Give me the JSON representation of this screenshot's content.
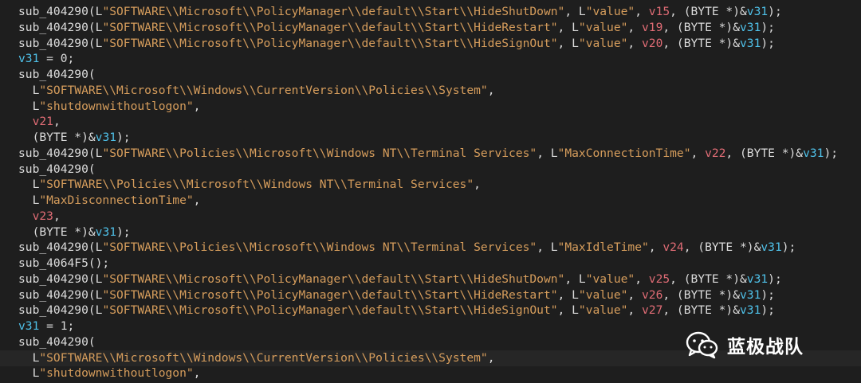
{
  "watermark": {
    "text": "蓝极战队",
    "icon": "wechat-icon"
  },
  "colors": {
    "background": "#1e1e1e",
    "plain": "#dcdcdc",
    "string": "#d69d5c",
    "local_var": "#e06c75",
    "global_var": "#4fc1e9"
  },
  "lines": [
    [
      [
        "p",
        "sub_404290(L"
      ],
      [
        "s",
        "\"SOFTWARE\\\\Microsoft\\\\PolicyManager\\\\default\\\\Start\\\\HideShutDown\""
      ],
      [
        "p",
        ", L"
      ],
      [
        "s",
        "\"value\""
      ],
      [
        "p",
        ", "
      ],
      [
        "v",
        "v15"
      ],
      [
        "p",
        ", (BYTE *)&"
      ],
      [
        "g",
        "v31"
      ],
      [
        "p",
        ");"
      ]
    ],
    [
      [
        "p",
        "sub_404290(L"
      ],
      [
        "s",
        "\"SOFTWARE\\\\Microsoft\\\\PolicyManager\\\\default\\\\Start\\\\HideRestart\""
      ],
      [
        "p",
        ", L"
      ],
      [
        "s",
        "\"value\""
      ],
      [
        "p",
        ", "
      ],
      [
        "v",
        "v19"
      ],
      [
        "p",
        ", (BYTE *)&"
      ],
      [
        "g",
        "v31"
      ],
      [
        "p",
        ");"
      ]
    ],
    [
      [
        "p",
        "sub_404290(L"
      ],
      [
        "s",
        "\"SOFTWARE\\\\Microsoft\\\\PolicyManager\\\\default\\\\Start\\\\HideSignOut\""
      ],
      [
        "p",
        ", L"
      ],
      [
        "s",
        "\"value\""
      ],
      [
        "p",
        ", "
      ],
      [
        "v",
        "v20"
      ],
      [
        "p",
        ", (BYTE *)&"
      ],
      [
        "g",
        "v31"
      ],
      [
        "p",
        ");"
      ]
    ],
    [
      [
        "g",
        "v31"
      ],
      [
        "p",
        " = 0;"
      ]
    ],
    [
      [
        "p",
        "sub_404290("
      ]
    ],
    [
      [
        "p",
        "  L"
      ],
      [
        "s",
        "\"SOFTWARE\\\\Microsoft\\\\Windows\\\\CurrentVersion\\\\Policies\\\\System\""
      ],
      [
        "p",
        ","
      ]
    ],
    [
      [
        "p",
        "  L"
      ],
      [
        "s",
        "\"shutdownwithoutlogon\""
      ],
      [
        "p",
        ","
      ]
    ],
    [
      [
        "p",
        "  "
      ],
      [
        "v",
        "v21"
      ],
      [
        "p",
        ","
      ]
    ],
    [
      [
        "p",
        "  (BYTE *)&"
      ],
      [
        "g",
        "v31"
      ],
      [
        "p",
        ");"
      ]
    ],
    [
      [
        "p",
        "sub_404290(L"
      ],
      [
        "s",
        "\"SOFTWARE\\\\Policies\\\\Microsoft\\\\Windows NT\\\\Terminal Services\""
      ],
      [
        "p",
        ", L"
      ],
      [
        "s",
        "\"MaxConnectionTime\""
      ],
      [
        "p",
        ", "
      ],
      [
        "v",
        "v22"
      ],
      [
        "p",
        ", (BYTE *)&"
      ],
      [
        "g",
        "v31"
      ],
      [
        "p",
        ");"
      ]
    ],
    [
      [
        "p",
        "sub_404290("
      ]
    ],
    [
      [
        "p",
        "  L"
      ],
      [
        "s",
        "\"SOFTWARE\\\\Policies\\\\Microsoft\\\\Windows NT\\\\Terminal Services\""
      ],
      [
        "p",
        ","
      ]
    ],
    [
      [
        "p",
        "  L"
      ],
      [
        "s",
        "\"MaxDisconnectionTime\""
      ],
      [
        "p",
        ","
      ]
    ],
    [
      [
        "p",
        "  "
      ],
      [
        "v",
        "v23"
      ],
      [
        "p",
        ","
      ]
    ],
    [
      [
        "p",
        "  (BYTE *)&"
      ],
      [
        "g",
        "v31"
      ],
      [
        "p",
        ");"
      ]
    ],
    [
      [
        "p",
        "sub_404290(L"
      ],
      [
        "s",
        "\"SOFTWARE\\\\Policies\\\\Microsoft\\\\Windows NT\\\\Terminal Services\""
      ],
      [
        "p",
        ", L"
      ],
      [
        "s",
        "\"MaxIdleTime\""
      ],
      [
        "p",
        ", "
      ],
      [
        "v",
        "v24"
      ],
      [
        "p",
        ", (BYTE *)&"
      ],
      [
        "g",
        "v31"
      ],
      [
        "p",
        ");"
      ]
    ],
    [
      [
        "p",
        "sub_4064F5();"
      ]
    ],
    [
      [
        "p",
        "sub_404290(L"
      ],
      [
        "s",
        "\"SOFTWARE\\\\Microsoft\\\\PolicyManager\\\\default\\\\Start\\\\HideShutDown\""
      ],
      [
        "p",
        ", L"
      ],
      [
        "s",
        "\"value\""
      ],
      [
        "p",
        ", "
      ],
      [
        "v",
        "v25"
      ],
      [
        "p",
        ", (BYTE *)&"
      ],
      [
        "g",
        "v31"
      ],
      [
        "p",
        ");"
      ]
    ],
    [
      [
        "p",
        "sub_404290(L"
      ],
      [
        "s",
        "\"SOFTWARE\\\\Microsoft\\\\PolicyManager\\\\default\\\\Start\\\\HideRestart\""
      ],
      [
        "p",
        ", L"
      ],
      [
        "s",
        "\"value\""
      ],
      [
        "p",
        ", "
      ],
      [
        "v",
        "v26"
      ],
      [
        "p",
        ", (BYTE *)&"
      ],
      [
        "g",
        "v31"
      ],
      [
        "p",
        ");"
      ]
    ],
    [
      [
        "p",
        "sub_404290(L"
      ],
      [
        "s",
        "\"SOFTWARE\\\\Microsoft\\\\PolicyManager\\\\default\\\\Start\\\\HideSignOut\""
      ],
      [
        "p",
        ", L"
      ],
      [
        "s",
        "\"value\""
      ],
      [
        "p",
        ", "
      ],
      [
        "v",
        "v27"
      ],
      [
        "p",
        ", (BYTE *)&"
      ],
      [
        "g",
        "v31"
      ],
      [
        "p",
        ");"
      ]
    ],
    [
      [
        "g",
        "v31"
      ],
      [
        "p",
        " = 1;"
      ]
    ],
    [
      [
        "p",
        "sub_404290("
      ]
    ],
    [
      [
        "p",
        "  L"
      ],
      [
        "s",
        "\"SOFTWARE\\\\Microsoft\\\\Windows\\\\CurrentVersion\\\\Policies\\\\System\""
      ],
      [
        "p",
        ","
      ]
    ],
    [
      [
        "p",
        "  L"
      ],
      [
        "s",
        "\"shutdownwithoutlogon\""
      ],
      [
        "p",
        ","
      ]
    ]
  ],
  "highlighted_line": 22
}
